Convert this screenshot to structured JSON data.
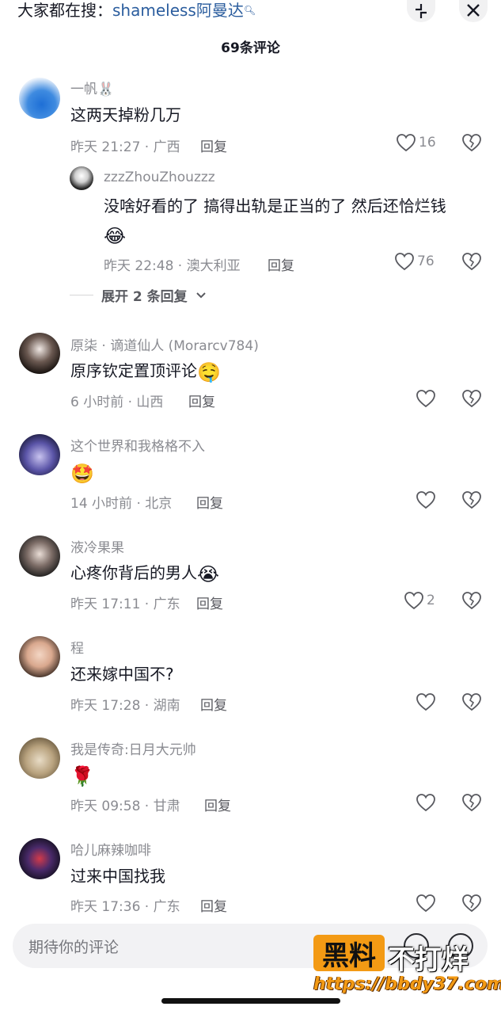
{
  "search": {
    "prefix": "大家都在搜：",
    "keyword": "shameless阿曼达",
    "icon": "search-icon"
  },
  "header": {
    "title": "69条评论",
    "collapse_icon": "collapse-icon",
    "close_icon": "close-icon"
  },
  "comments": [
    {
      "name": "一帆🐰",
      "text": "这两天掉粉几万",
      "emoji": "",
      "meta": "昨天 21:27 · 广西",
      "reply": "回复",
      "likes": "16",
      "replies": [
        {
          "name": "zzzZhouZhouzzz",
          "text": "没啥好看的了 搞得出轨是正当的了 然后还恰烂钱",
          "emoji": "😂",
          "meta": "昨天 22:48 · 澳大利亚",
          "reply": "回复",
          "likes": "76"
        }
      ],
      "expand_label": "展开 2 条回复"
    },
    {
      "name": "原柒 · 谪道仙人 (Morarcv784)",
      "text": "原序钦定置顶评论",
      "emoji": "🤤",
      "meta": "6 小时前 · 山西",
      "reply": "回复",
      "likes": ""
    },
    {
      "name": "这个世界和我格格不入",
      "text": "",
      "emoji": "🤩",
      "meta": "14 小时前 · 北京",
      "reply": "回复",
      "likes": ""
    },
    {
      "name": "液冷果果",
      "text": "心疼你背后的男人",
      "emoji": "😭",
      "meta": "昨天 17:11 · 广东",
      "reply": "回复",
      "likes": "2"
    },
    {
      "name": "程",
      "text": "还来嫁中国不?",
      "emoji": "",
      "meta": "昨天 17:28 · 湖南",
      "reply": "回复",
      "likes": ""
    },
    {
      "name": "我是传奇:日月大元帅",
      "text": "",
      "emoji": "🌹",
      "meta": "昨天 09:58 · 甘肃",
      "reply": "回复",
      "likes": ""
    },
    {
      "name": "哈儿麻辣咖啡",
      "text": "过来中国找我",
      "emoji": "",
      "meta": "昨天 17:36 · 广东",
      "reply": "回复",
      "likes": ""
    }
  ],
  "input": {
    "placeholder": "期待你的评论"
  },
  "watermark": {
    "box": "黑料",
    "text": "不打烊",
    "url": "https://bbdy37.com"
  },
  "colors": {
    "accent_link": "#2b5d9e",
    "meta_gray": "#8a8b91",
    "watermark_orange": "#f39a14"
  }
}
